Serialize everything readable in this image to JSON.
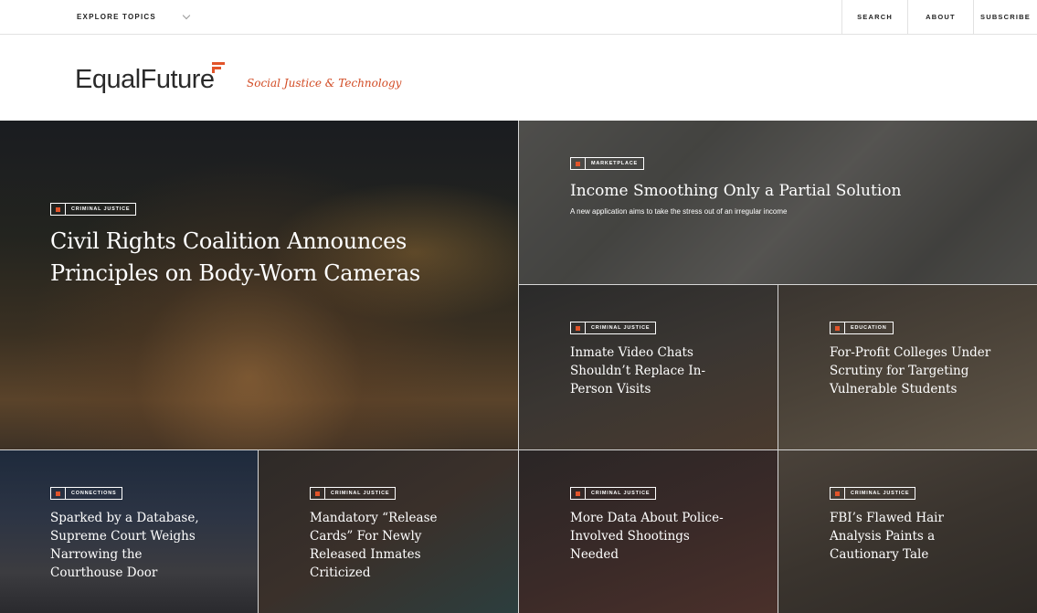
{
  "nav": {
    "explore_label": "EXPLORE TOPICS",
    "links": [
      "SEARCH",
      "ABOUT",
      "SUBSCRIBE"
    ]
  },
  "brand": {
    "logo_text": "EqualFuture",
    "tagline": "Social Justice & Technology",
    "accent_color": "#e2542a"
  },
  "featured": {
    "tag": "CRIMINAL JUSTICE",
    "title_line1": "Civil Rights Coalition Announces",
    "title_line2": "Principles on Body-Worn Cameras"
  },
  "wide_story": {
    "tag": "MARKETPLACE",
    "title": "Income Smoothing Only a Partial Solution",
    "subtitle": "A new application aims to take the stress out of an irregular income"
  },
  "stories": [
    {
      "tag": "CRIMINAL JUSTICE",
      "lines": [
        "Inmate Video Chats",
        "Shouldn’t Replace In-",
        "Person Visits"
      ]
    },
    {
      "tag": "EDUCATION",
      "lines": [
        "For-Profit Colleges Under",
        "Scrutiny for Targeting",
        "Vulnerable Students"
      ]
    },
    {
      "tag": "CONNECTIONS",
      "lines": [
        "Sparked by a Database,",
        "Supreme Court Weighs",
        "Narrowing the",
        "Courthouse Door"
      ]
    },
    {
      "tag": "CRIMINAL JUSTICE",
      "lines": [
        "Mandatory “Release",
        "Cards” For Newly",
        "Released Inmates",
        "Criticized"
      ]
    },
    {
      "tag": "CRIMINAL JUSTICE",
      "lines": [
        "More Data About Police-",
        "Involved Shootings",
        "Needed"
      ]
    },
    {
      "tag": "CRIMINAL JUSTICE",
      "lines": [
        "FBI’s Flawed Hair",
        "Analysis Paints a",
        "Cautionary Tale"
      ]
    }
  ]
}
